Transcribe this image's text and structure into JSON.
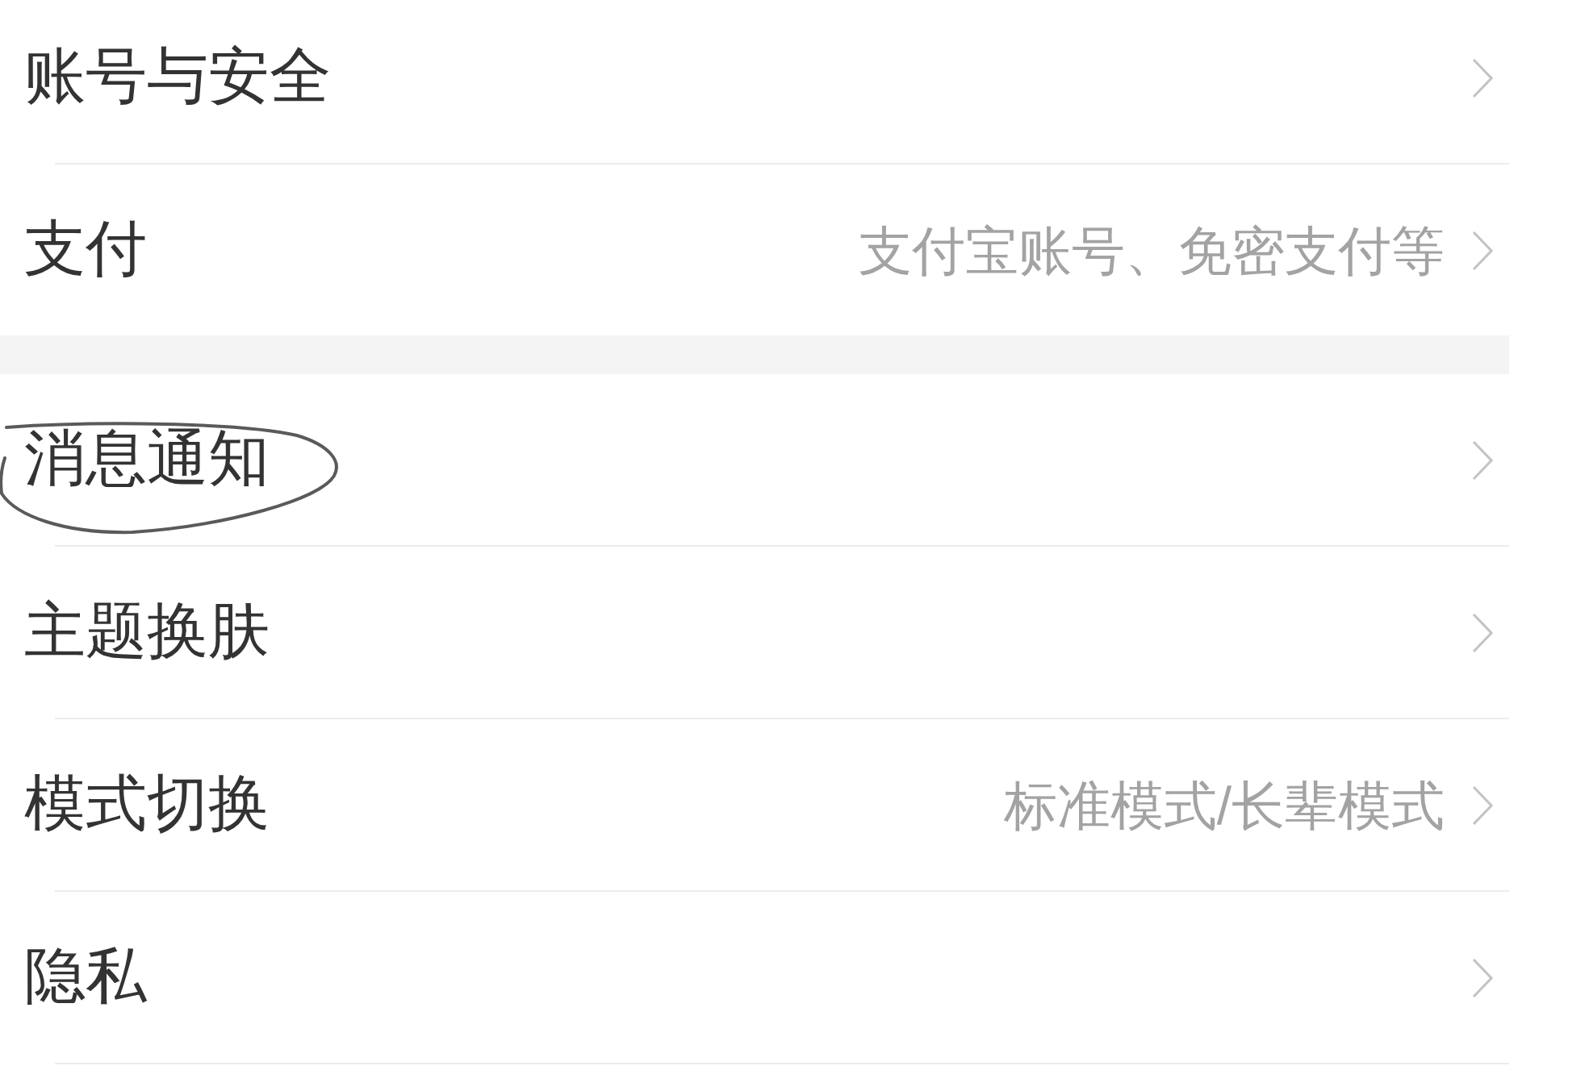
{
  "sections": [
    {
      "items": [
        {
          "label": "账号与安全",
          "circled": false
        },
        {
          "label": "支付",
          "value": "支付宝账号、免密支付等",
          "circled": false
        }
      ]
    },
    {
      "items": [
        {
          "label": "消息通知",
          "circled": true
        },
        {
          "label": "主题换肤",
          "circled": false
        },
        {
          "label": "模式切换",
          "value": "标准模式/长辈模式",
          "circled": false
        },
        {
          "label": "隐私",
          "circled": false
        }
      ]
    }
  ]
}
